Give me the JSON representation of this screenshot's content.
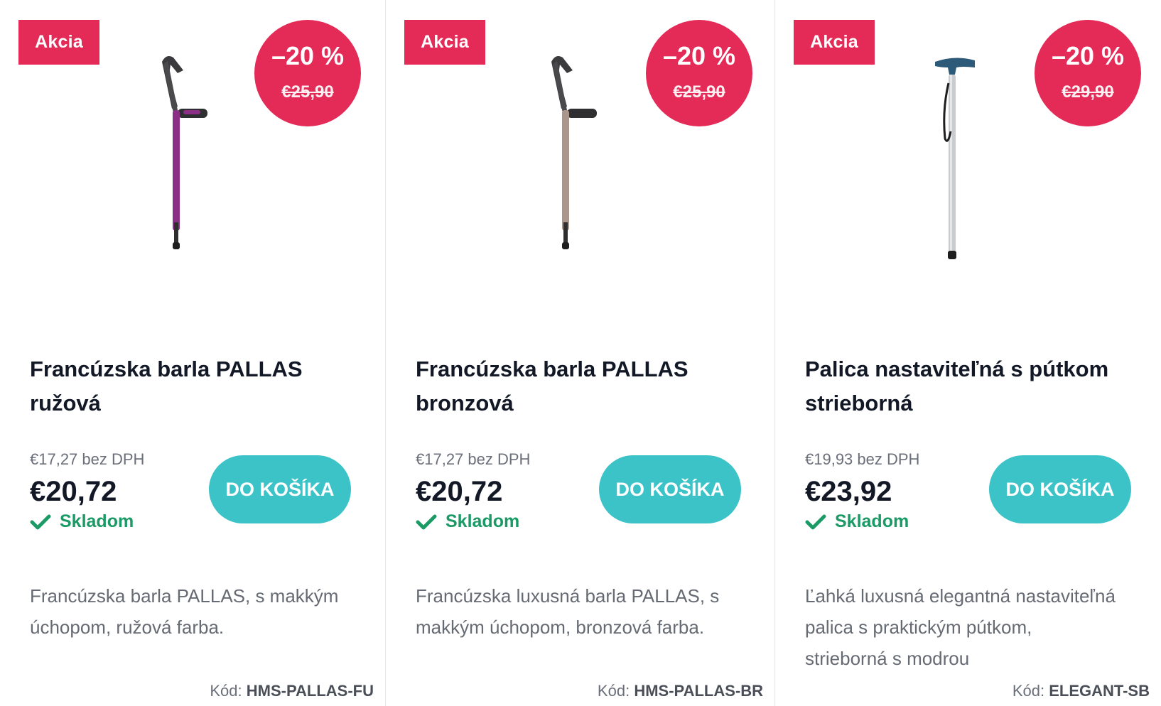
{
  "products": [
    {
      "flag": "Akcia",
      "discount": "–20 %",
      "old_price": "€25,90",
      "name": "Francúzska barla PALLAS ružová",
      "price_net": "€17,27 bez DPH",
      "price": "€20,72",
      "stock": "Skladom",
      "cart_label": "DO KOŠÍKA",
      "description": "Francúzska barla PALLAS, s makkým úchopom, ružová farba.",
      "code_label": "Kód:",
      "code": "HMS-PALLAS-FU",
      "shaft_color": "#8b2f86"
    },
    {
      "flag": "Akcia",
      "discount": "–20 %",
      "old_price": "€25,90",
      "name": "Francúzska barla PALLAS bronzová",
      "price_net": "€17,27 bez DPH",
      "price": "€20,72",
      "stock": "Skladom",
      "cart_label": "DO KOŠÍKA",
      "description": "Francúzska luxusná barla PALLAS, s makkým úchopom, bronzová farba.",
      "code_label": "Kód:",
      "code": "HMS-PALLAS-BR",
      "shaft_color": "#a8978a"
    },
    {
      "flag": "Akcia",
      "discount": "–20 %",
      "old_price": "€29,90",
      "name": "Palica nastaviteľná s pútkom strieborná",
      "price_net": "€19,93 bez DPH",
      "price": "€23,92",
      "stock": "Skladom",
      "cart_label": "DO KOŠÍKA",
      "description": "Ľahká luxusná elegantná nastaviteľná palica s praktickým pútkom, strieborná s modrou",
      "code_label": "Kód:",
      "code": "ELEGANT-SB",
      "shaft_color": "#c9cbcf"
    }
  ],
  "colors": {
    "accent_red": "#e42a57",
    "cart_button": "#3cc3c8",
    "stock_green": "#1c9a66"
  }
}
